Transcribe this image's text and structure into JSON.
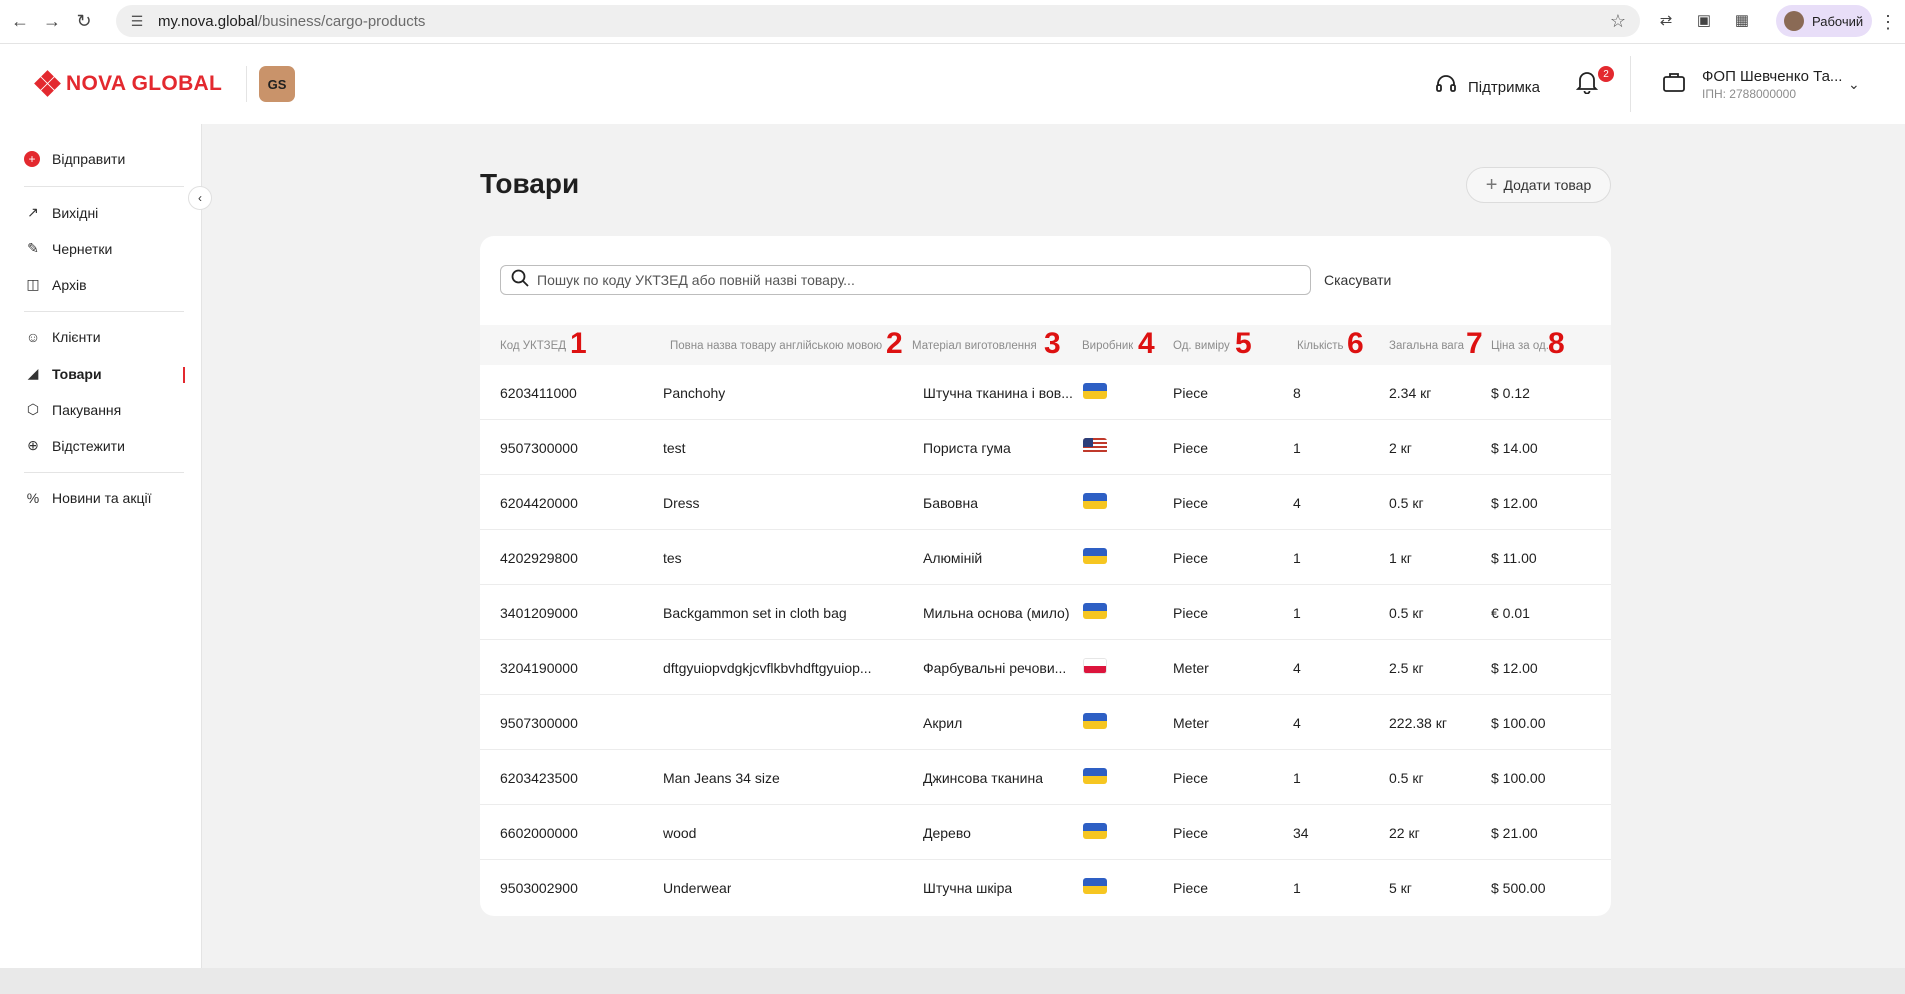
{
  "browser": {
    "url_host": "my.nova.global",
    "url_path": "/business/cargo-products",
    "profile_label": "Рабочий"
  },
  "header": {
    "logo_text": "NOVA GLOBAL",
    "badge_text": "GS",
    "support_label": "Підтримка",
    "notifications_count": "2",
    "account_name": "ФОП Шевченко Та...",
    "account_inn": "ІПН: 2788000000"
  },
  "sidebar": {
    "send_label": "Відправити",
    "items": [
      {
        "label": "Вихідні"
      },
      {
        "label": "Чернетки"
      },
      {
        "label": "Архів"
      },
      {
        "label": "Клієнти"
      },
      {
        "label": "Товари"
      },
      {
        "label": "Пакування"
      },
      {
        "label": "Відстежити"
      },
      {
        "label": "Новини та акції"
      }
    ],
    "active_index": 4
  },
  "main": {
    "title": "Товари",
    "add_button_label": "Додати товар",
    "search_placeholder": "Пошук по коду УКТЗЕД або повній назві товару...",
    "cancel_label": "Скасувати"
  },
  "table": {
    "headers": [
      {
        "label": "Код УКТЗЕД",
        "marker": "1"
      },
      {
        "label": "Повна назва товару англійською мовою",
        "marker": "2"
      },
      {
        "label": "Матеріал виготовлення",
        "marker": "3"
      },
      {
        "label": "Виробник",
        "marker": "4"
      },
      {
        "label": "Од. виміру",
        "marker": "5"
      },
      {
        "label": "Кількість",
        "marker": "6"
      },
      {
        "label": "Загальна вага",
        "marker": "7"
      },
      {
        "label": "Ціна за од.",
        "marker": "8"
      }
    ],
    "rows": [
      {
        "code": "6203411000",
        "name": "Panchohy",
        "material": "Штучна тканина і вов...",
        "flag": "ua",
        "unit": "Piece",
        "qty": "8",
        "weight": "2.34 кг",
        "price": "$ 0.12"
      },
      {
        "code": "9507300000",
        "name": "test",
        "material": "Пориста гума",
        "flag": "us",
        "unit": "Piece",
        "qty": "1",
        "weight": "2 кг",
        "price": "$ 14.00"
      },
      {
        "code": "6204420000",
        "name": "Dress",
        "material": "Бавовна",
        "flag": "ua",
        "unit": "Piece",
        "qty": "4",
        "weight": "0.5 кг",
        "price": "$ 12.00"
      },
      {
        "code": "4202929800",
        "name": "tes",
        "material": "Алюміній",
        "flag": "ua",
        "unit": "Piece",
        "qty": "1",
        "weight": "1 кг",
        "price": "$ 11.00"
      },
      {
        "code": "3401209000",
        "name": "Backgammon set in cloth bag",
        "material": "Мильна основа (мило)",
        "flag": "ua",
        "unit": "Piece",
        "qty": "1",
        "weight": "0.5 кг",
        "price": "€ 0.01"
      },
      {
        "code": "3204190000",
        "name": "dftgyuiopvdgkjcvflkbvhdftgyuiop...",
        "material": "Фарбувальні речови...",
        "flag": "pl",
        "unit": "Meter",
        "qty": "4",
        "weight": "2.5 кг",
        "price": "$ 12.00"
      },
      {
        "code": "9507300000",
        "name": "",
        "material": "Акрил",
        "flag": "ua",
        "unit": "Meter",
        "qty": "4",
        "weight": "222.38 кг",
        "price": "$ 100.00"
      },
      {
        "code": "6203423500",
        "name": "Man Jeans 34 size",
        "material": "Джинсова тканина",
        "flag": "ua",
        "unit": "Piece",
        "qty": "1",
        "weight": "0.5 кг",
        "price": "$ 100.00"
      },
      {
        "code": "6602000000",
        "name": "wood",
        "material": "Дерево",
        "flag": "ua",
        "unit": "Piece",
        "qty": "34",
        "weight": "22 кг",
        "price": "$ 21.00"
      },
      {
        "code": "9503002900",
        "name": "Underwear",
        "material": "Штучна шкіра",
        "flag": "ua",
        "unit": "Piece",
        "qty": "1",
        "weight": "5 кг",
        "price": "$ 500.00"
      }
    ]
  },
  "colors": {
    "brand_red": "#e3292f",
    "marker_red": "#dd1111",
    "ua_blue": "#2e5fc4",
    "ua_yellow": "#f6c621",
    "pl_white": "#ffffff",
    "pl_red": "#dc143c"
  }
}
